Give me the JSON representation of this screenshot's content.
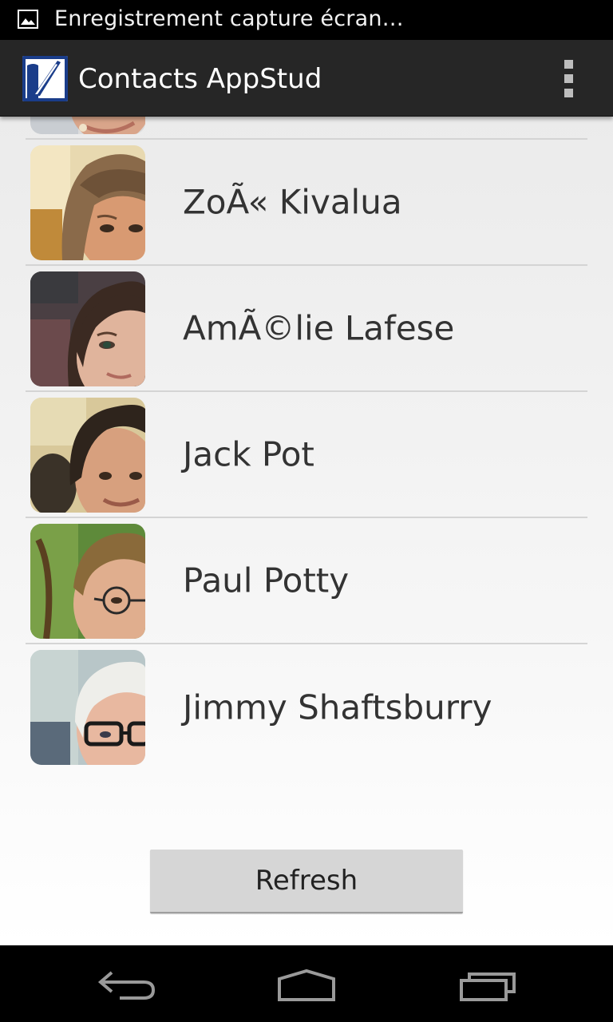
{
  "status_bar": {
    "notification_text": "Enregistrement capture écran…",
    "icon": "image-notification-icon"
  },
  "action_bar": {
    "title": "Contacts AppStud",
    "logo_icon": "appstud-logo-icon",
    "menu_icon": "overflow-menu-icon"
  },
  "contacts": [
    {
      "name": "",
      "avatar": "partial-portrait"
    },
    {
      "name": "ZoÃ« Kivalua",
      "avatar": "woman-bangs-portrait"
    },
    {
      "name": "AmÃ©lie Lafese",
      "avatar": "woman-dark-hair-portrait"
    },
    {
      "name": "Jack Pot",
      "avatar": "man-dark-hair-portrait"
    },
    {
      "name": "Paul Potty",
      "avatar": "man-glasses-portrait"
    },
    {
      "name": "Jimmy Shaftsburry",
      "avatar": "man-white-hair-glasses-portrait"
    }
  ],
  "refresh_label": "Refresh",
  "nav_bar": {
    "back_icon": "back-icon",
    "home_icon": "home-icon",
    "recents_icon": "recent-apps-icon"
  },
  "colors": {
    "action_bar": "#262626",
    "background": "#ebebeb",
    "divider": "#d4d4d4",
    "button": "#d6d6d6",
    "text": "#333333"
  }
}
